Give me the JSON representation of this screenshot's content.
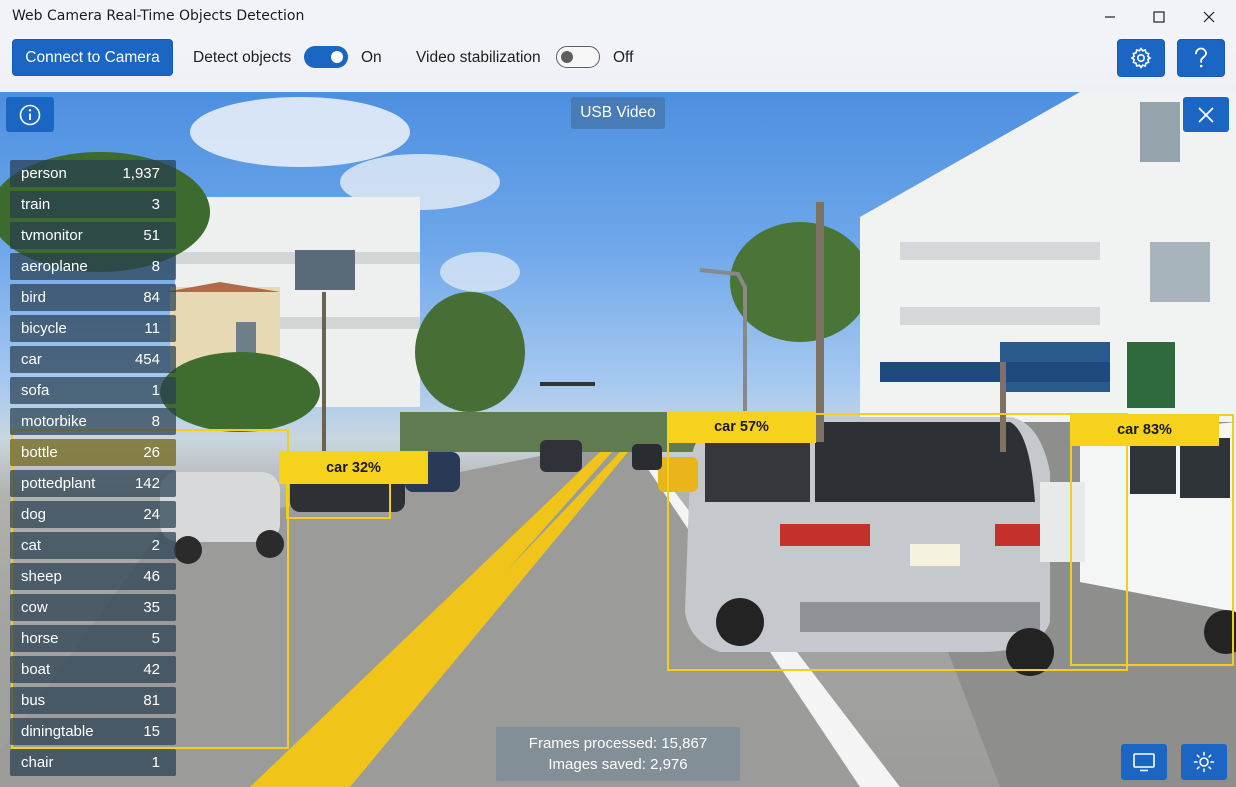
{
  "window": {
    "title": "Web Camera Real-Time Objects Detection"
  },
  "window_controls": {
    "minimize": "minimize-icon",
    "maximize": "maximize-icon",
    "close": "close-icon"
  },
  "toolbar": {
    "connect_label": "Connect to Camera",
    "detect_label": "Detect objects",
    "detect_state": "On",
    "stabilization_label": "Video stabilization",
    "stabilization_state": "Off",
    "settings_icon": "gear-icon",
    "help_icon": "help-icon"
  },
  "camera": {
    "source": "USB Video",
    "info_icon": "info-icon",
    "close_icon": "close-icon"
  },
  "classes": [
    {
      "name": "person",
      "count": "1,937"
    },
    {
      "name": "train",
      "count": "3"
    },
    {
      "name": "tvmonitor",
      "count": "51"
    },
    {
      "name": "aeroplane",
      "count": "8"
    },
    {
      "name": "bird",
      "count": "84"
    },
    {
      "name": "bicycle",
      "count": "11"
    },
    {
      "name": "car",
      "count": "454"
    },
    {
      "name": "sofa",
      "count": "1"
    },
    {
      "name": "motorbike",
      "count": "8"
    },
    {
      "name": "bottle",
      "count": "26"
    },
    {
      "name": "pottedplant",
      "count": "142"
    },
    {
      "name": "dog",
      "count": "24"
    },
    {
      "name": "cat",
      "count": "2"
    },
    {
      "name": "sheep",
      "count": "46"
    },
    {
      "name": "cow",
      "count": "35"
    },
    {
      "name": "horse",
      "count": "5"
    },
    {
      "name": "boat",
      "count": "42"
    },
    {
      "name": "bus",
      "count": "81"
    },
    {
      "name": "diningtable",
      "count": "15"
    },
    {
      "name": "chair",
      "count": "1"
    }
  ],
  "detections": [
    {
      "label": "car 32%"
    },
    {
      "label": "car 57%"
    },
    {
      "label": "car 83%"
    }
  ],
  "stats": {
    "frames_processed": "Frames processed: 15,867",
    "images_saved": "Images saved: 2,976"
  },
  "bottom_buttons": {
    "display_icon": "monitor-icon",
    "brightness_icon": "brightness-icon"
  },
  "colors": {
    "accent": "#1a66c2",
    "detection": "#f2cf1d"
  }
}
